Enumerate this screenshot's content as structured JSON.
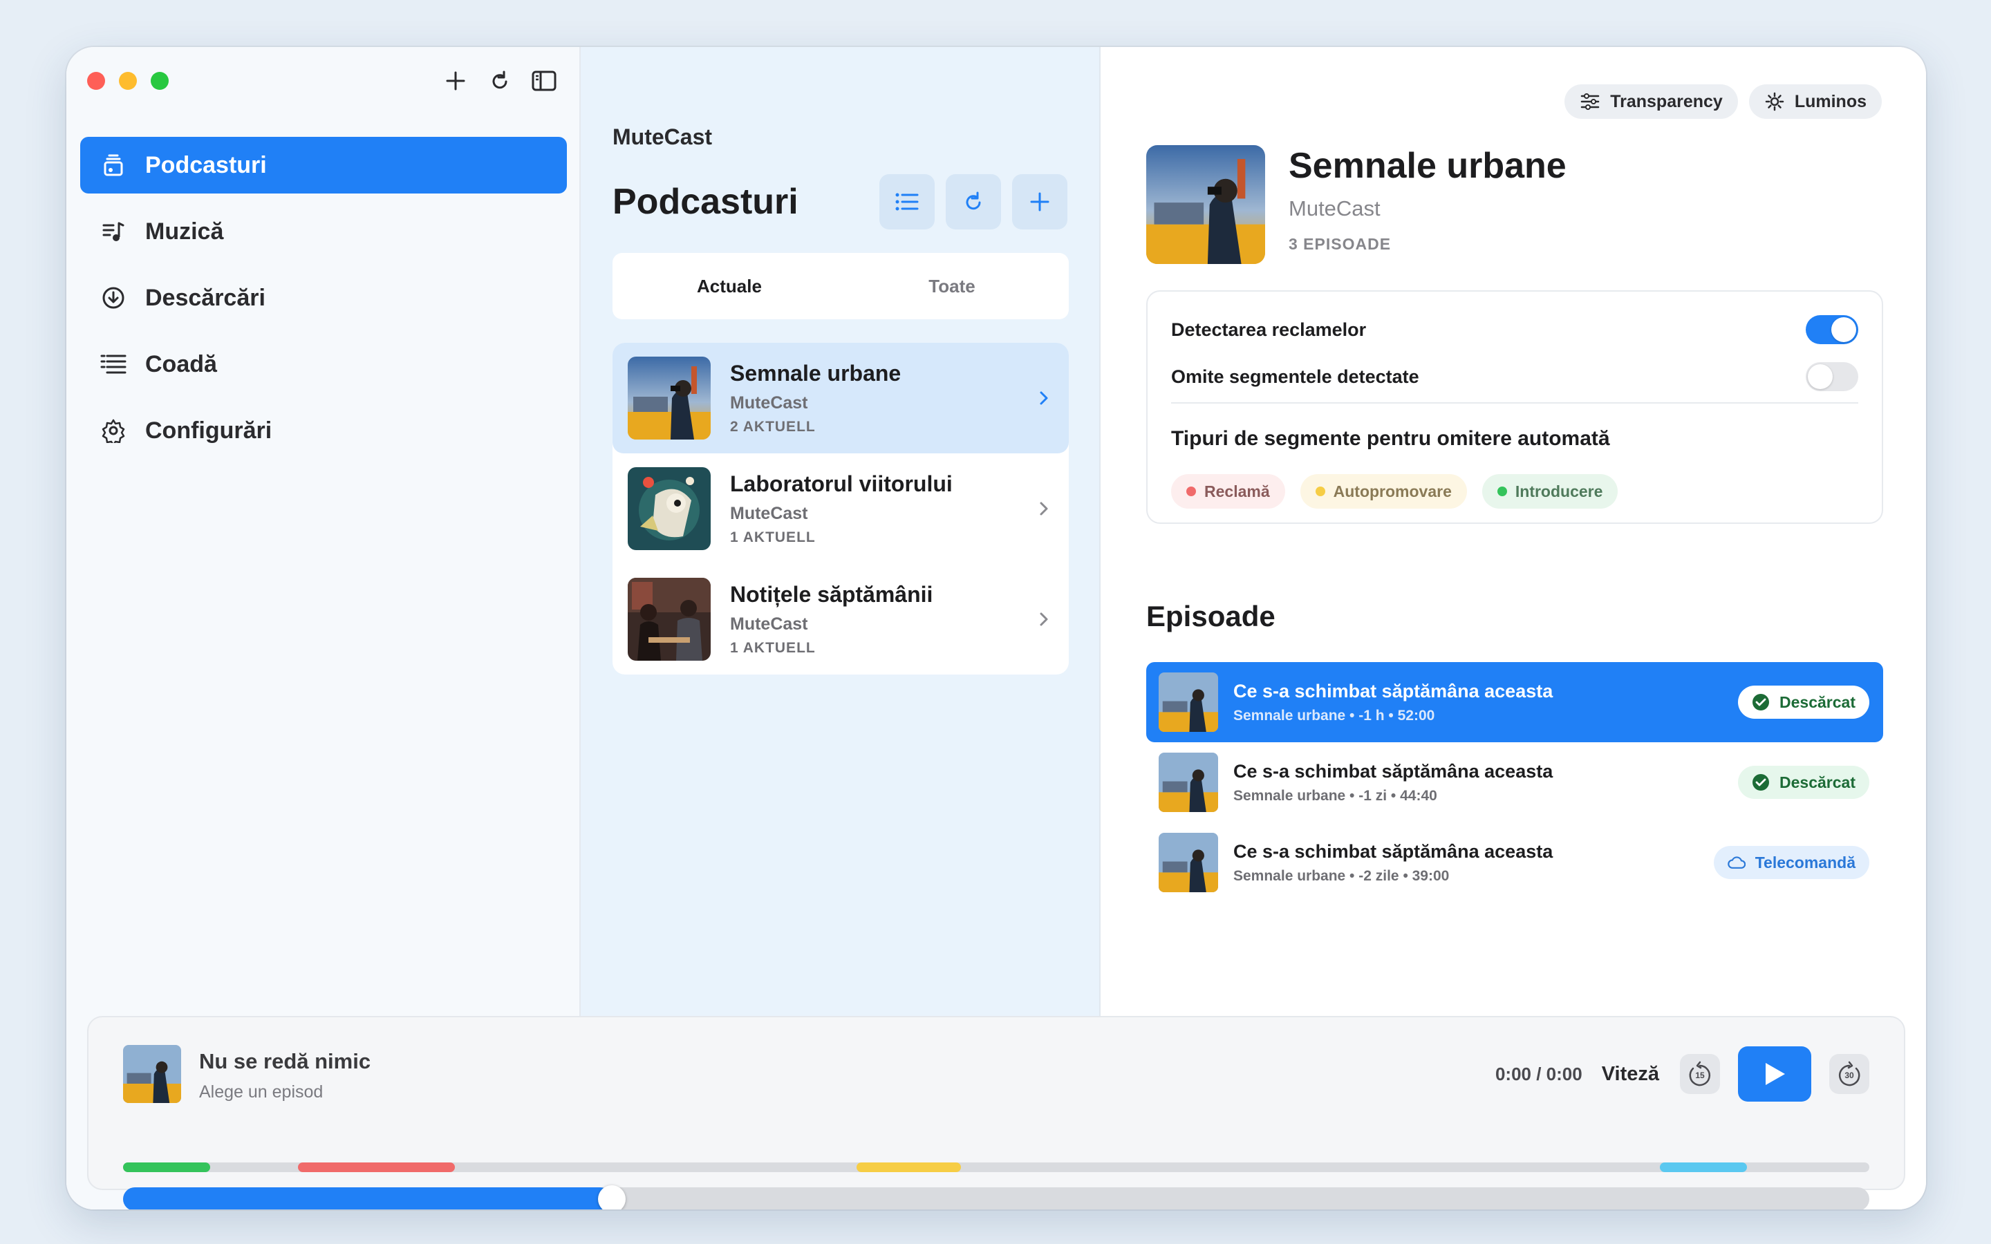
{
  "window": {
    "sidebar": {
      "items": [
        {
          "label": "Podcasturi",
          "icon": "podcast-stack-icon",
          "active": true
        },
        {
          "label": "Muzică",
          "icon": "music-list-icon",
          "active": false
        },
        {
          "label": "Descărcări",
          "icon": "download-circle-icon",
          "active": false
        },
        {
          "label": "Coadă",
          "icon": "queue-list-icon",
          "active": false
        },
        {
          "label": "Configurări",
          "icon": "gear-icon",
          "active": false
        }
      ]
    },
    "middle": {
      "app_name": "MuteCast",
      "title": "Podcasturi",
      "segments": [
        "Actuale",
        "Toate"
      ],
      "podcasts": [
        {
          "title": "Semnale urbane",
          "author": "MuteCast",
          "count": "2 AKTUELL"
        },
        {
          "title": "Laboratorul viitorului",
          "author": "MuteCast",
          "count": "1 AKTUELL"
        },
        {
          "title": "Notițele săptămânii",
          "author": "MuteCast",
          "count": "1 AKTUELL"
        }
      ]
    },
    "detail": {
      "pills": [
        "Transparency",
        "Luminos"
      ],
      "title": "Semnale urbane",
      "author": "MuteCast",
      "count": "3 EPISOADE",
      "settings": {
        "detect_ads": "Detectarea reclamelor",
        "detect_ads_on": true,
        "skip_segments": "Omite segmentele detectate",
        "skip_segments_on": false,
        "types_title": "Tipuri de segmente pentru omitere automată",
        "tags": [
          "Reclamă",
          "Autopromovare",
          "Introducere"
        ]
      },
      "episodes_heading": "Episoade",
      "episodes": [
        {
          "title": "Ce s-a schimbat săptămâna aceasta",
          "meta": "Semnale urbane • -1 h • 52:00",
          "status": "Descărcat"
        },
        {
          "title": "Ce s-a schimbat săptămâna aceasta",
          "meta": "Semnale urbane • -1 zi • 44:40",
          "status": "Descărcat"
        },
        {
          "title": "Ce s-a schimbat săptămâna aceasta",
          "meta": "Semnale urbane • -2 zile • 39:00",
          "status": "Telecomandă"
        }
      ]
    },
    "player": {
      "title": "Nu se redă nimic",
      "subtitle": "Alege un episod",
      "time": "0:00 / 0:00",
      "speed_label": "Viteză",
      "skip_back": "15",
      "skip_forward": "30",
      "progress_fraction": 0.28,
      "segment_markers": [
        {
          "type": "Introducere",
          "start": 0.0,
          "end": 0.05
        },
        {
          "type": "Reclamă",
          "start": 0.1,
          "end": 0.19
        },
        {
          "type": "Autopromovare",
          "start": 0.42,
          "end": 0.48
        },
        {
          "type": "other",
          "start": 0.88,
          "end": 0.93
        }
      ]
    }
  },
  "colors": {
    "accent": "#2080f6",
    "ad_red": "#f06a6a",
    "promo_yellow": "#f6cd45",
    "intro_green": "#34c35b",
    "other_cyan": "#5ac8f0"
  }
}
